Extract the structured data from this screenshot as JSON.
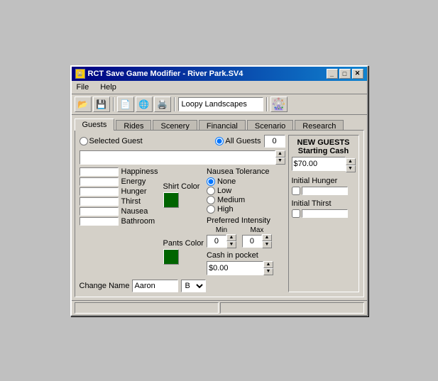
{
  "window": {
    "title": "RCT Save Game Modifier - River Park.SV4",
    "icon": "🎡"
  },
  "menubar": {
    "items": [
      "File",
      "Help"
    ]
  },
  "toolbar": {
    "buttons": [
      "📂",
      "💾",
      "📄",
      "🌐",
      "🖨️"
    ],
    "dropdown_value": "Loopy Landscapes",
    "ride_icon": "🎡"
  },
  "tabs": {
    "items": [
      "Guests",
      "Rides",
      "Scenery",
      "Financial",
      "Scenario",
      "Research"
    ],
    "active": 0
  },
  "guests_panel": {
    "selected_guest_label": "Selected Guest",
    "all_guests_label": "All Guests",
    "guest_number": "0",
    "dropdown_value": "",
    "stats": [
      {
        "label": "Happiness"
      },
      {
        "label": "Energy"
      },
      {
        "label": "Hunger"
      },
      {
        "label": "Thirst"
      },
      {
        "label": "Nausea"
      },
      {
        "label": "Bathroom"
      }
    ],
    "shirt_color_label": "Shirt Color",
    "pants_color_label": "Pants Color",
    "nausea_tolerance_label": "Nausea Tolerance",
    "nausea_options": [
      "None",
      "Low",
      "Medium",
      "High"
    ],
    "nausea_selected": "None",
    "preferred_intensity_label": "Preferred Intensity",
    "intensity_min_label": "Min",
    "intensity_max_label": "Max",
    "intensity_min_value": "0",
    "intensity_max_value": "0",
    "cash_in_pocket_label": "Cash in pocket",
    "cash_value": "$0.00",
    "change_name_label": "Change Name",
    "name_value": "Aaron",
    "b_value": "B"
  },
  "new_guests_panel": {
    "title": "NEW GUESTS",
    "starting_cash_label": "Starting Cash",
    "starting_cash_value": "$70.00",
    "initial_hunger_label": "Initial Hunger",
    "initial_thirst_label": "Initial Thirst"
  },
  "statusbar": {
    "panels": [
      "",
      ""
    ]
  }
}
